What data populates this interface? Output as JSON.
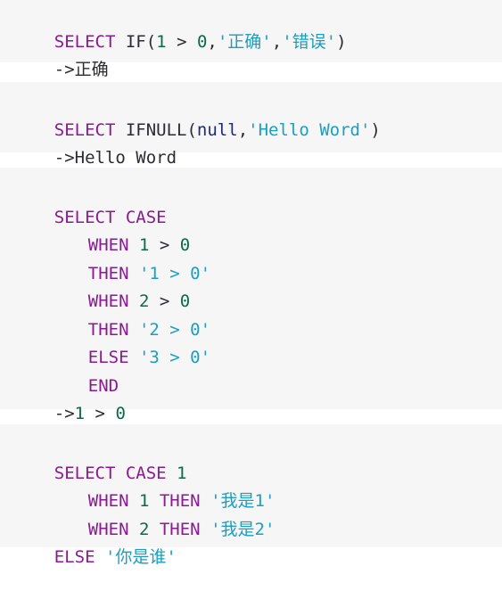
{
  "blocks": [
    {
      "lines": [
        [
          {
            "t": "SELECT IF(",
            "c": "kw-mix"
          },
          {
            "t": "1",
            "c": "num"
          },
          {
            "t": " > ",
            "c": "plain"
          },
          {
            "t": "0",
            "c": "num"
          },
          {
            "t": ",",
            "c": "plain"
          },
          {
            "t": "'正确'",
            "c": "str"
          },
          {
            "t": ",",
            "c": "plain"
          },
          {
            "t": "'错误'",
            "c": "str"
          },
          {
            "t": ")",
            "c": "plain"
          }
        ],
        [
          {
            "t": "->正确",
            "c": "plain"
          }
        ]
      ]
    },
    {
      "lines": [
        [
          {
            "t": "SELECT ",
            "c": "kw"
          },
          {
            "t": "IFNULL(",
            "c": "plain"
          },
          {
            "t": "null",
            "c": "null-kw"
          },
          {
            "t": ",",
            "c": "plain"
          },
          {
            "t": "'Hello Word'",
            "c": "str"
          },
          {
            "t": ")",
            "c": "plain"
          }
        ],
        [
          {
            "t": "->Hello Word",
            "c": "plain"
          }
        ]
      ]
    },
    {
      "lines": [
        [
          {
            "t": "SELECT CASE",
            "c": "kw"
          }
        ],
        [
          {
            "t": "WHEN ",
            "c": "kw",
            "indent": true
          },
          {
            "t": "1",
            "c": "num"
          },
          {
            "t": " > ",
            "c": "plain"
          },
          {
            "t": "0",
            "c": "num"
          }
        ],
        [
          {
            "t": "THEN ",
            "c": "kw",
            "indent": true
          },
          {
            "t": "'1 > 0'",
            "c": "str"
          }
        ],
        [
          {
            "t": "WHEN ",
            "c": "kw",
            "indent": true
          },
          {
            "t": "2",
            "c": "num"
          },
          {
            "t": " > ",
            "c": "plain"
          },
          {
            "t": "0",
            "c": "num"
          }
        ],
        [
          {
            "t": "THEN ",
            "c": "kw",
            "indent": true
          },
          {
            "t": "'2 > 0'",
            "c": "str"
          }
        ],
        [
          {
            "t": "ELSE ",
            "c": "kw",
            "indent": true
          },
          {
            "t": "'3 > 0'",
            "c": "str"
          }
        ],
        [
          {
            "t": "END",
            "c": "kw",
            "indent": true
          }
        ],
        [
          {
            "t": "->",
            "c": "plain"
          },
          {
            "t": "1",
            "c": "num"
          },
          {
            "t": " > ",
            "c": "plain"
          },
          {
            "t": "0",
            "c": "num"
          }
        ]
      ]
    },
    {
      "lines": [
        [
          {
            "t": "SELECT CASE ",
            "c": "kw"
          },
          {
            "t": "1",
            "c": "num"
          }
        ],
        [
          {
            "t": "WHEN ",
            "c": "kw",
            "indent": true
          },
          {
            "t": "1",
            "c": "num"
          },
          {
            "t": " THEN ",
            "c": "kw"
          },
          {
            "t": "'我是1'",
            "c": "str"
          }
        ],
        [
          {
            "t": "WHEN ",
            "c": "kw",
            "indent": true
          },
          {
            "t": "2",
            "c": "num"
          },
          {
            "t": " THEN ",
            "c": "kw"
          },
          {
            "t": "'我是2'",
            "c": "str"
          }
        ],
        [
          {
            "t": "ELSE ",
            "c": "kw"
          },
          {
            "t": "'你是谁'",
            "c": "str"
          }
        ]
      ]
    }
  ]
}
